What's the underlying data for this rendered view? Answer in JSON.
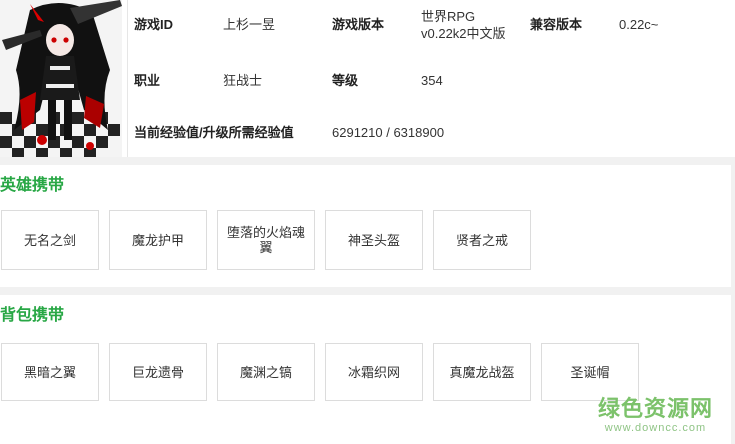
{
  "info": {
    "game_id_label": "游戏ID",
    "game_id_value": "上杉一昱",
    "game_version_label": "游戏版本",
    "game_version_line1": "世界RPG",
    "game_version_line2": "v0.22k2中文版",
    "compat_label": "兼容版本",
    "compat_value": "0.22c~",
    "job_label": "职业",
    "job_value": "狂战士",
    "level_label": "等级",
    "level_value": "354",
    "exp_label": "当前经验值/升级所需经验值",
    "exp_value": "6291210 / 6318900"
  },
  "hero": {
    "title": "英雄携带",
    "items": [
      "无名之剑",
      "魔龙护甲",
      "堕落的火焰魂翼",
      "神圣头盔",
      "贤者之戒"
    ]
  },
  "bag": {
    "title": "背包携带",
    "items": [
      "黑暗之翼",
      "巨龙遗骨",
      "魔渊之镐",
      "冰霜织网",
      "真魔龙战盔",
      "圣诞帽"
    ]
  },
  "watermark": {
    "title": "绿色资源网",
    "url": "www.downcc.com"
  },
  "colors": {
    "section_title": "#28a745",
    "page_bg": "#f1f1f1",
    "card_border": "#dcdcdc"
  },
  "icons": {
    "avatar": "anime-character-avatar"
  }
}
